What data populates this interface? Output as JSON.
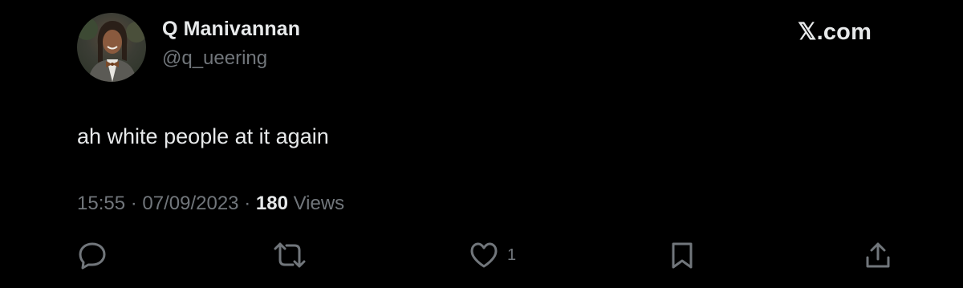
{
  "author": {
    "display_name": "Q Manivannan",
    "handle": "@q_ueering"
  },
  "brand": {
    "label": "𝕏.com"
  },
  "tweet": {
    "text": "ah white people at it again"
  },
  "meta": {
    "time": "15:55",
    "separator": "·",
    "date": "07/09/2023",
    "views_count": "180",
    "views_label": "Views"
  },
  "actions": {
    "reply_icon": "reply-icon",
    "retweet_icon": "retweet-icon",
    "like_icon": "heart-icon",
    "like_count": "1",
    "bookmark_icon": "bookmark-icon",
    "share_icon": "share-icon"
  },
  "colors": {
    "background": "#000000",
    "primary_text": "#e7e9ea",
    "secondary_text": "#71767b"
  }
}
